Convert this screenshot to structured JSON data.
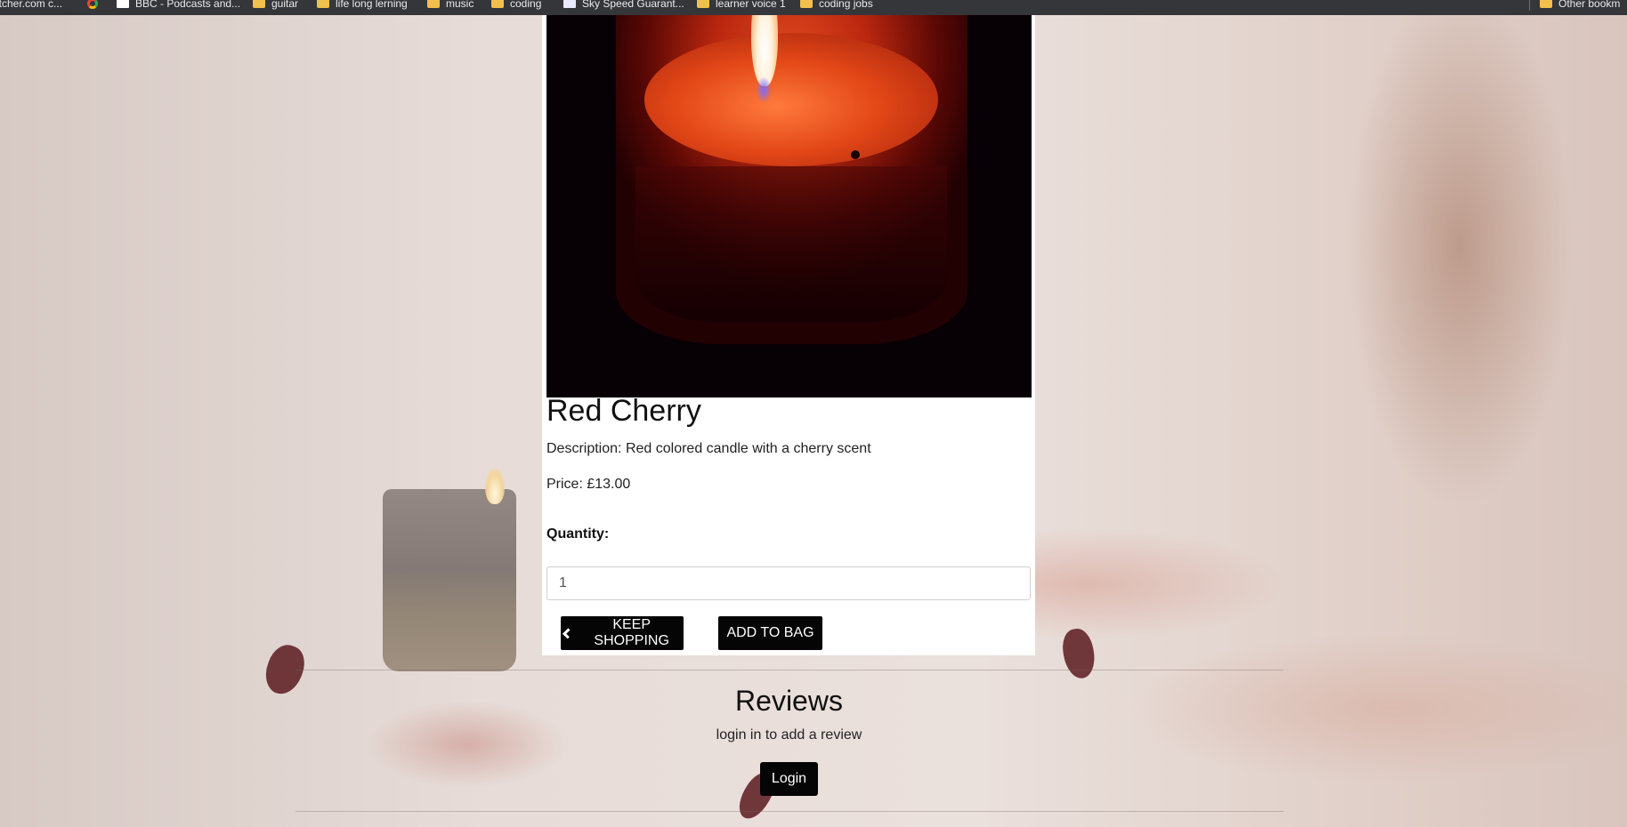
{
  "bookmarks": [
    {
      "label": "atcher.com c...",
      "icon": "page-icon"
    },
    {
      "label": "",
      "icon": "google-icon"
    },
    {
      "label": "BBC - Podcasts and...",
      "icon": "page-icon"
    },
    {
      "label": "guitar",
      "icon": "folder-icon"
    },
    {
      "label": "life long lerning",
      "icon": "folder-icon"
    },
    {
      "label": "music",
      "icon": "folder-icon"
    },
    {
      "label": "coding",
      "icon": "folder-icon"
    },
    {
      "label": "Sky Speed Guarant...",
      "icon": "sky-icon"
    },
    {
      "label": "learner voice 1",
      "icon": "folder-icon"
    },
    {
      "label": "coding jobs",
      "icon": "folder-icon"
    },
    {
      "label": "Other bookm",
      "icon": "folder-icon"
    }
  ],
  "product": {
    "name": "Red Cherry",
    "description_label": "Description:",
    "description": "Red colored candle with a cherry scent",
    "price_label": "Price:",
    "price": "£13.00",
    "quantity_label": "Quantity:",
    "quantity_value": "1",
    "keep_shopping_label": "KEEP SHOPPING",
    "add_to_bag_label": "ADD TO BAG"
  },
  "reviews": {
    "heading": "Reviews",
    "note": "login in to add a review",
    "login_label": "Login"
  },
  "colors": {
    "button_bg": "#050505",
    "button_text": "#ffffff",
    "bookmark_bar_bg": "#35363a"
  }
}
